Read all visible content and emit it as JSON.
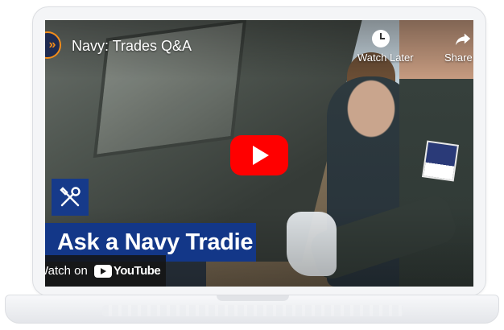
{
  "video": {
    "title": "Navy: Trades Q&A",
    "channel_logo_glyph": "»",
    "watch_later_label": "Watch Later",
    "share_label": "Share",
    "overlay_banner_text": "Ask a Navy Tradie",
    "watch_on_label": "Watch on",
    "youtube_wordmark": "YouTube"
  },
  "icons": {
    "channel": "navy-logo-icon",
    "watch_later": "clock-icon",
    "share": "share-arrow-icon",
    "play": "play-icon",
    "tools": "wrench-screwdriver-icon",
    "youtube": "youtube-logo-icon"
  },
  "colors": {
    "play_button": "#ff0000",
    "banner_blue": "#133788",
    "channel_accent": "#f28c1a"
  }
}
